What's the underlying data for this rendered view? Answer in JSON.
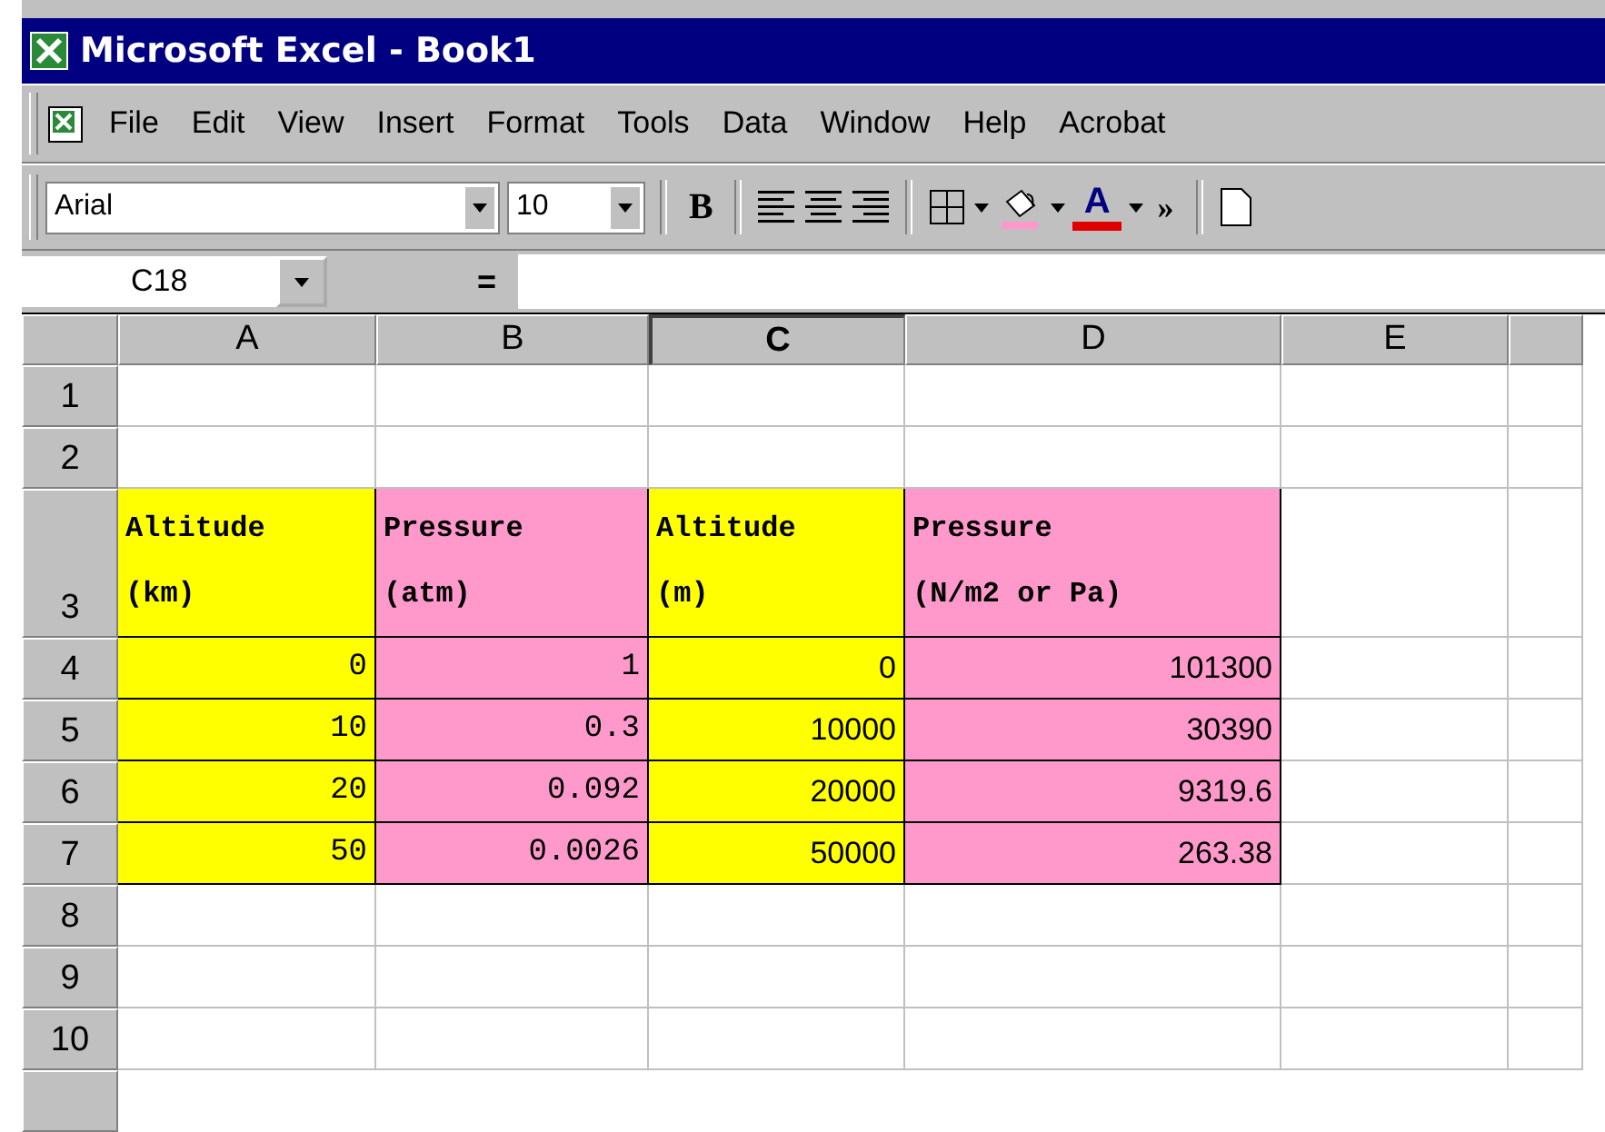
{
  "window": {
    "title": "Microsoft Excel - Book1"
  },
  "menu": [
    "File",
    "Edit",
    "View",
    "Insert",
    "Format",
    "Tools",
    "Data",
    "Window",
    "Help",
    "Acrobat"
  ],
  "toolbar": {
    "font": "Arial",
    "size": "10",
    "bold": "B",
    "font_color": "A",
    "more": "»"
  },
  "formula_bar": {
    "name_box": "C18",
    "equals": "="
  },
  "columns": [
    {
      "label": "A",
      "selected": false,
      "color": "#ffff00"
    },
    {
      "label": "B",
      "selected": false,
      "color": "#ff99cc"
    },
    {
      "label": "C",
      "selected": true,
      "color": "#ffff00"
    },
    {
      "label": "D",
      "selected": false,
      "color": "#ff99cc"
    },
    {
      "label": "E",
      "selected": false
    },
    {
      "selected": false
    }
  ],
  "rows": [
    {
      "header": "1",
      "cells": []
    },
    {
      "header": "2",
      "cells": []
    },
    {
      "header": "3",
      "kind": "heading",
      "cells": [
        "Altitude\n(km)",
        "Pressure\n(atm)",
        "Altitude\n(m)",
        "Pressure\n(N/m2 or Pa)"
      ]
    },
    {
      "header": "4",
      "kind": "number",
      "cells": [
        "0",
        "1",
        "0",
        "101300"
      ]
    },
    {
      "header": "5",
      "kind": "number",
      "cells": [
        "10",
        "0.3",
        "10000",
        "30390"
      ]
    },
    {
      "header": "6",
      "kind": "number",
      "cells": [
        "20",
        "0.092",
        "20000",
        "9319.6"
      ]
    },
    {
      "header": "7",
      "kind": "number",
      "cells": [
        "50",
        "0.0026",
        "50000",
        "263.38"
      ]
    },
    {
      "header": "8",
      "cells": []
    },
    {
      "header": "9",
      "cells": []
    },
    {
      "header": "10",
      "cells": []
    }
  ]
}
